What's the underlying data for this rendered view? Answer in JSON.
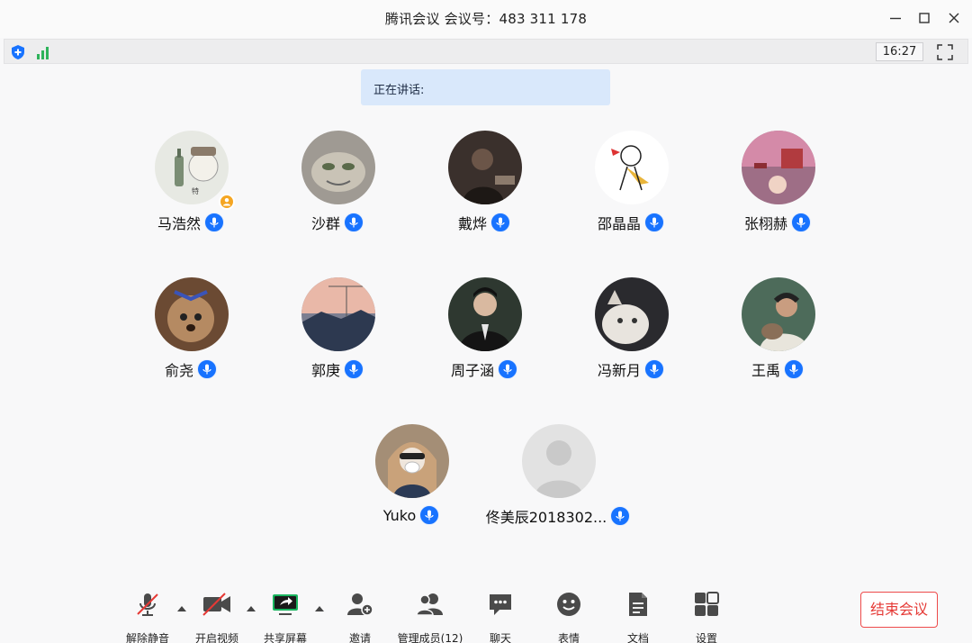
{
  "window": {
    "title": "腾讯会议 会议号：483 311 178"
  },
  "status": {
    "time": "16:27",
    "icons": [
      "shield-icon",
      "signal-icon",
      "fullscreen-icon"
    ]
  },
  "speaking": {
    "label": "正在讲话:"
  },
  "participants": [
    {
      "name": "马浩然",
      "avatar_color": "#e7e9e3",
      "host": true
    },
    {
      "name": "沙群",
      "avatar_color": "#9f9a93",
      "host": false
    },
    {
      "name": "戴烨",
      "avatar_color": "#3a302c",
      "host": false
    },
    {
      "name": "邵晶晶",
      "avatar_color": "#ffffff",
      "host": false
    },
    {
      "name": "张栩赫",
      "avatar_color": "#9e6e86",
      "host": false
    },
    {
      "name": "俞尧",
      "avatar_color": "#6b4a33",
      "host": false
    },
    {
      "name": "郭庚",
      "avatar_color": "#7c7f91",
      "host": false
    },
    {
      "name": "周子涵",
      "avatar_color": "#2e3830",
      "host": false
    },
    {
      "name": "冯新月",
      "avatar_color": "#2a2a2e",
      "host": false
    },
    {
      "name": "王禹",
      "avatar_color": "#4d6b5a",
      "host": false
    },
    {
      "name": "Yuko",
      "avatar_color": "#a48e76",
      "host": false
    },
    {
      "name": "佟美辰2018302...",
      "avatar_color": "#e2e2e2",
      "host": false
    }
  ],
  "toolbar": {
    "unmute": "解除静音",
    "start_video": "开启视频",
    "share_screen": "共享屏幕",
    "invite": "邀请",
    "manage_members": "管理成员(12)",
    "chat": "聊天",
    "emoji": "表情",
    "docs": "文档",
    "settings": "设置",
    "end_meeting": "结束会议"
  },
  "colors": {
    "accent": "#1873ff",
    "danger": "#e53935",
    "speaking_bg": "#d9e8fb",
    "share_green": "#19b55f",
    "host_badge": "#f5a623"
  }
}
